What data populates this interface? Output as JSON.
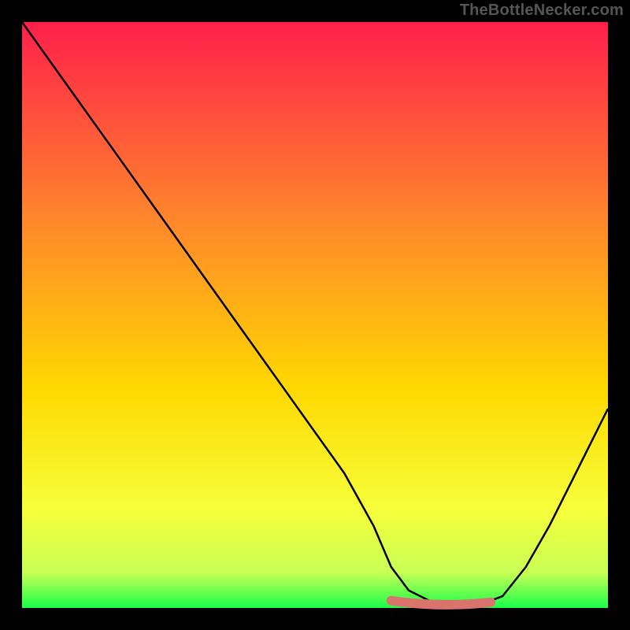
{
  "watermark": "TheBottleNecker.com",
  "colors": {
    "gradient_top": "#ff1f4b",
    "gradient_mid1": "#ff6a2a",
    "gradient_mid2": "#ffd700",
    "gradient_mid3": "#f7ff3a",
    "gradient_bottom": "#19ff4a",
    "curve": "#000000",
    "marker": "#d9736b"
  },
  "chart_data": {
    "type": "line",
    "title": "",
    "xlabel": "",
    "ylabel": "",
    "xlim": [
      0,
      100
    ],
    "ylim": [
      0,
      100
    ],
    "x": [
      0,
      5,
      10,
      15,
      20,
      25,
      30,
      35,
      40,
      45,
      50,
      55,
      60,
      63,
      66,
      70,
      74,
      78,
      82,
      86,
      90,
      94,
      98,
      100
    ],
    "values": [
      100,
      93,
      86,
      79,
      72,
      65,
      58,
      51,
      44,
      37,
      30,
      23,
      14,
      7,
      3,
      1,
      0.5,
      0.5,
      2,
      7,
      14,
      22,
      30,
      34
    ],
    "min_band": {
      "x_start": 63,
      "x_end": 80,
      "y": 0.7
    }
  }
}
